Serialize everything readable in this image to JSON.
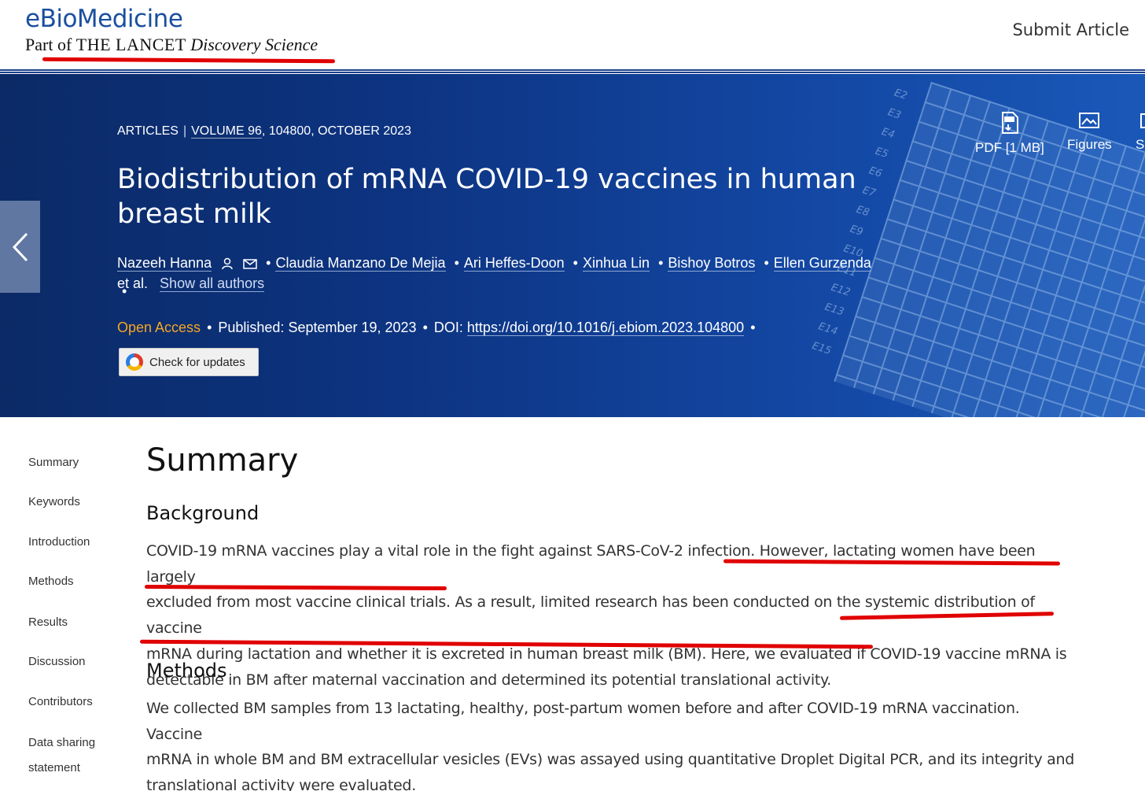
{
  "header": {
    "brand_name": "eBioMedicine",
    "brand_sub_prefix": "Part of",
    "brand_sub_lancet": "THE LANCET",
    "brand_sub_discovery": "Discovery Science",
    "submit_label": "Submit Article"
  },
  "article": {
    "type": "ARTICLES",
    "volume": "VOLUME 96",
    "issue": ", 104800, OCTOBER 2023",
    "title": "Biodistribution of mRNA COVID-19 vaccines in human breast milk",
    "authors": [
      "Nazeeh Hanna",
      "Claudia Manzano De Mejia",
      "Ari Heffes-Doon",
      "Xinhua Lin",
      "Bishoy Botros",
      "Ellen Gurzenda"
    ],
    "et_al": "et al.",
    "show_all": "Show all authors",
    "open_access": "Open Access",
    "published_label": "Published:",
    "published_date": "September 19, 2023",
    "doi_label": "DOI:",
    "doi": "https://doi.org/10.1016/j.ebiom.2023.104800",
    "check_updates": "Check for updates"
  },
  "tools": {
    "pdf": "PDF [1 MB]",
    "figures": "Figures",
    "share": "S"
  },
  "hero_labels": [
    "E2",
    "E3",
    "E4",
    "E5",
    "E6",
    "E7",
    "E8",
    "E9",
    "E10",
    "E11",
    "E12",
    "E13",
    "E14",
    "E15"
  ],
  "sidebar": {
    "items": [
      "Summary",
      "Keywords",
      "Introduction",
      "Methods",
      "Results",
      "Discussion",
      "Contributors",
      "Data sharing",
      "statement"
    ]
  },
  "summary": {
    "heading": "Summary",
    "background_heading": "Background",
    "background_lines": [
      "COVID-19 mRNA vaccines play a vital role in the fight against SARS-CoV-2 infection. However, lactating women have been largely",
      "excluded from most vaccine clinical trials. As a result, limited research has been conducted on the systemic distribution of vaccine",
      "mRNA during lactation and whether it is excreted in human breast milk (BM). Here, we evaluated if COVID-19 vaccine mRNA is",
      "detectable in BM after maternal vaccination and determined its potential translational activity."
    ],
    "methods_heading": "Methods",
    "methods_lines": [
      "We collected BM samples from 13 lactating, healthy, post-partum women before and after COVID-19 mRNA vaccination. Vaccine",
      "mRNA in whole BM and BM extracellular vesicles (EVs) was assayed using quantitative Droplet Digital PCR, and its integrity and",
      "translational activity were evaluated."
    ]
  },
  "colors": {
    "brand_blue": "#1a4fa0",
    "hero_dark": "#0b2a66",
    "open_access": "#f5a623",
    "annotation_red": "#e00000"
  },
  "icons": [
    "person-icon",
    "mail-icon",
    "pdf-icon",
    "image-icon",
    "chevron-left-icon",
    "crossmark-icon"
  ]
}
